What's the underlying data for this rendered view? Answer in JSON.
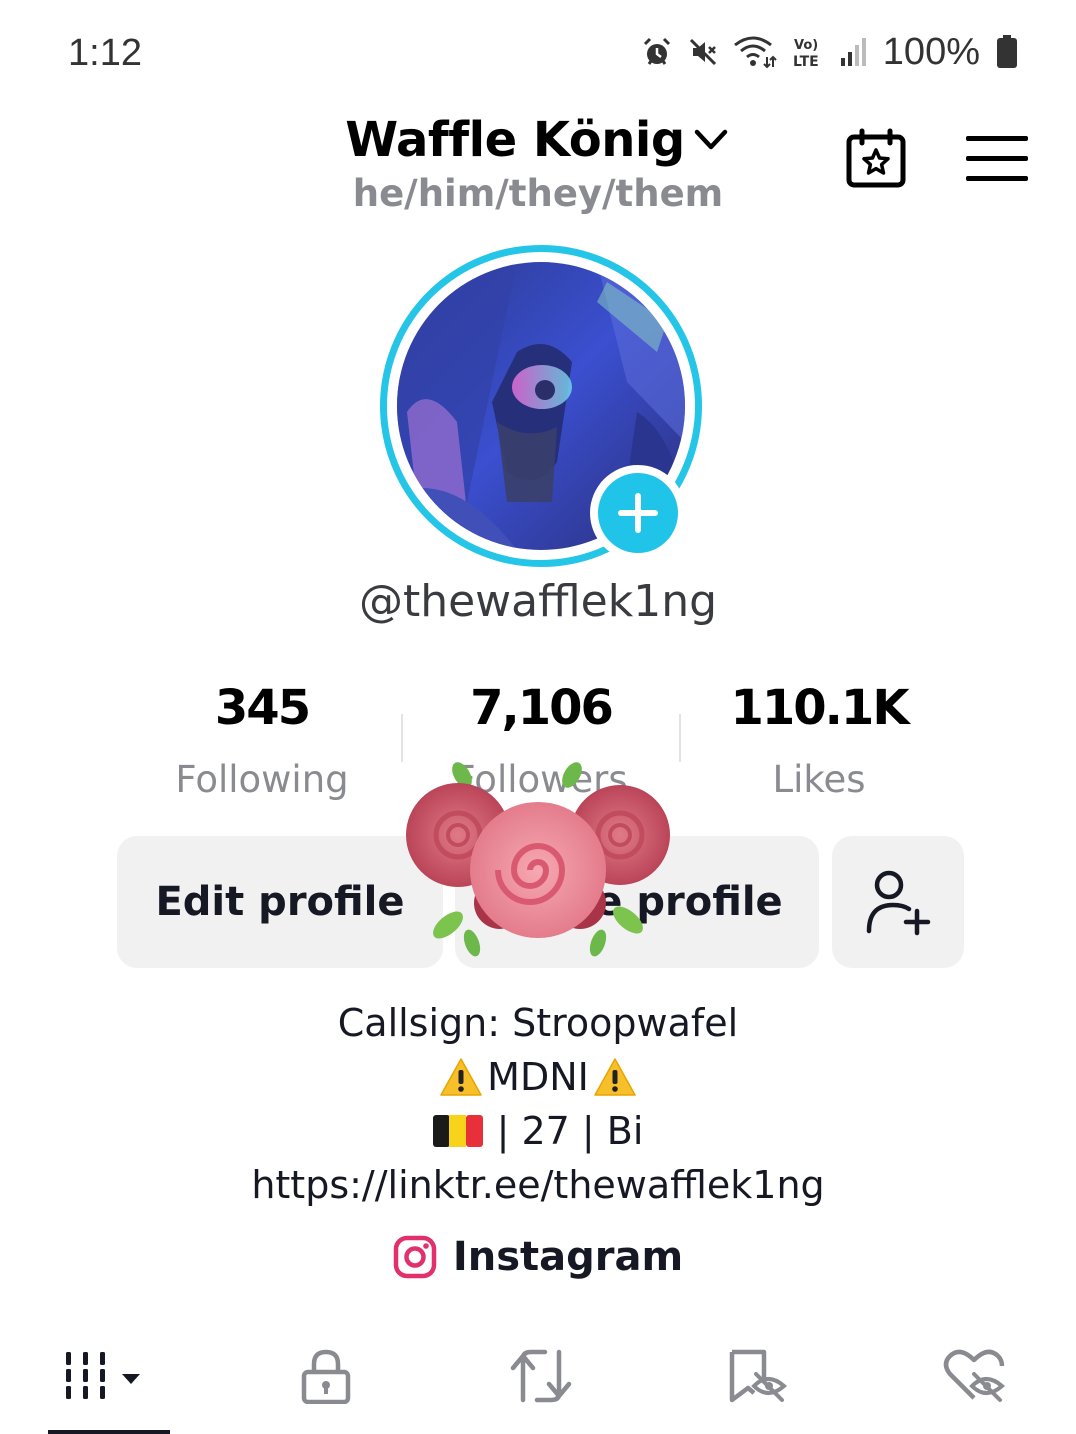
{
  "status_bar": {
    "time": "1:12",
    "battery": "100%",
    "icons": [
      "alarm-icon",
      "mute-icon",
      "wifi-icon",
      "volte-icon",
      "signal-icon",
      "battery-icon"
    ]
  },
  "header": {
    "profile_name": "Waffle König",
    "pronouns": "he/him/they/them",
    "icons": [
      "chevron-down-icon",
      "calendar-star-icon",
      "hamburger-menu-icon"
    ]
  },
  "profile": {
    "username": "@thewafflek1ng",
    "avatar": "avatar-photo",
    "add_story_icon": "plus-icon"
  },
  "stats": {
    "following": {
      "value": "345",
      "label": "Following"
    },
    "followers": {
      "value": "7,106",
      "label": "Followers"
    },
    "likes": {
      "value": "110.1K",
      "label": "Likes"
    }
  },
  "buttons": {
    "edit_profile": "Edit profile",
    "share_profile": "Share profile",
    "add_friend_icon": "add-friend-icon"
  },
  "bio": {
    "line1": "Callsign: Stroopwafel",
    "line2": "MDNI",
    "line3": "| 27 | Bi",
    "line4": "https://linktr.ee/thewafflek1ng"
  },
  "social": {
    "instagram": "Instagram"
  },
  "tabs": [
    "grid-videos-icon",
    "private-lock-icon",
    "repost-icon",
    "favorites-hidden-icon",
    "liked-hidden-icon"
  ],
  "colors": {
    "accent": "#25c5e8",
    "text": "#161823",
    "secondary_text": "#8a8b91",
    "button_bg": "#f1f1f2",
    "instagram": "#e1306c"
  }
}
